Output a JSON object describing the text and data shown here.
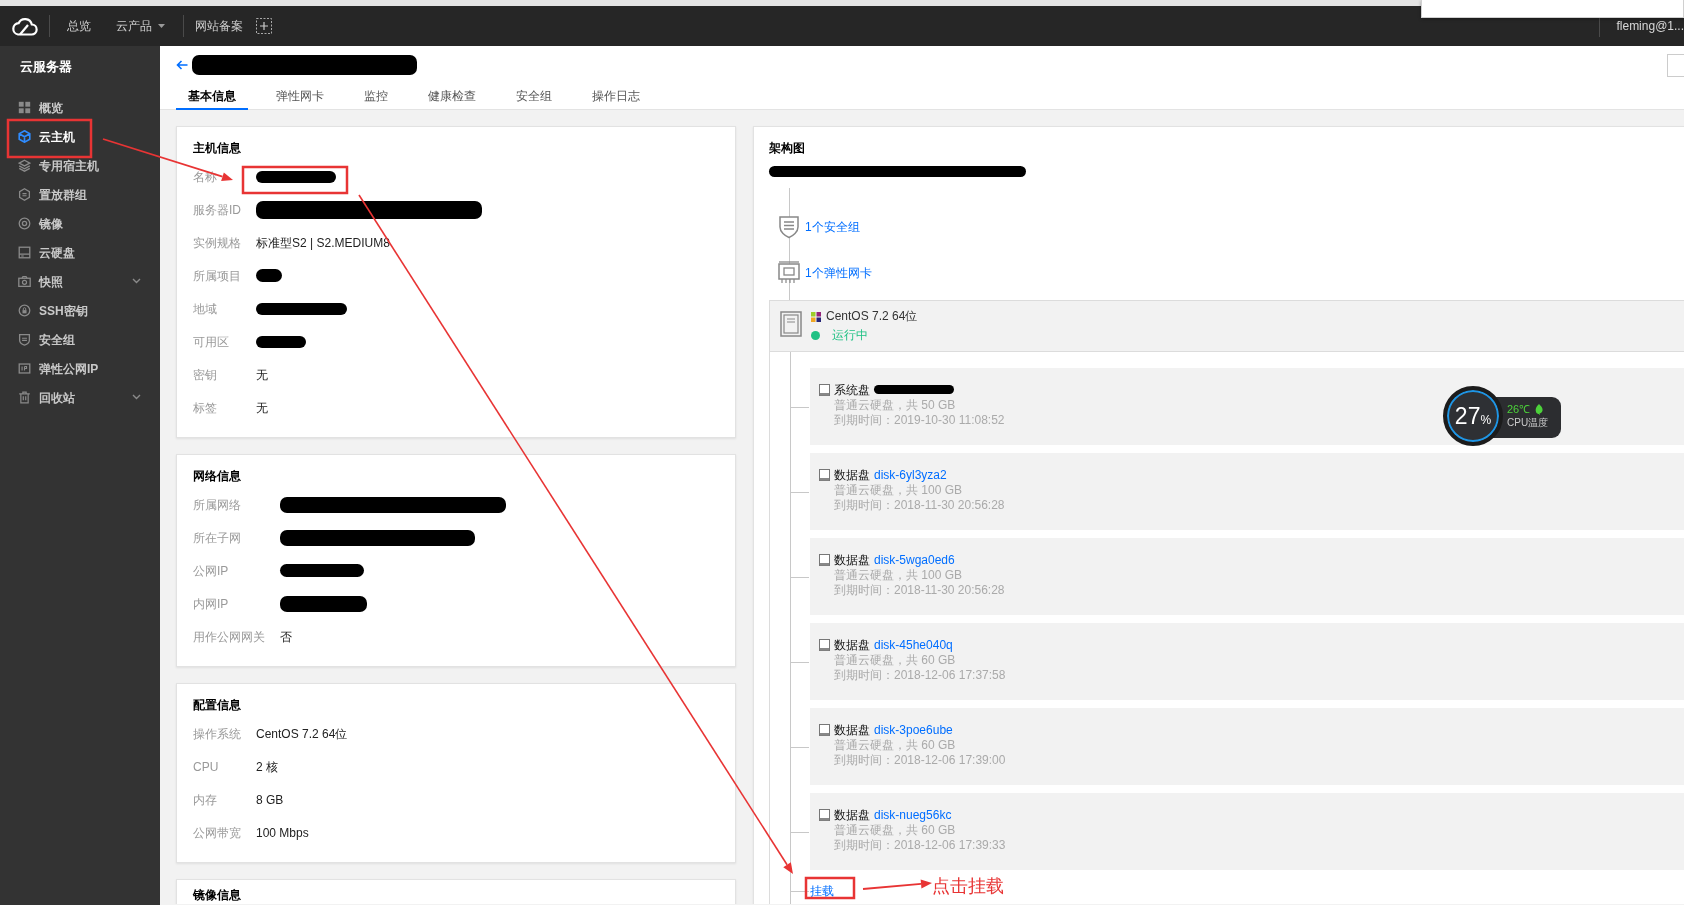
{
  "top_nav": {
    "items": [
      {
        "label": "总览",
        "kind": "link"
      },
      {
        "label": "云产品",
        "kind": "dropdown"
      },
      {
        "label": "网站备案",
        "kind": "link"
      }
    ],
    "user": "fleming@1..."
  },
  "sidebar": {
    "title": "云服务器",
    "items": [
      {
        "label": "概览",
        "kind": "overview",
        "selected": false,
        "expandable": false
      },
      {
        "label": "云主机",
        "kind": "instance",
        "selected": true,
        "expandable": false
      },
      {
        "label": "专用宿主机",
        "kind": "host",
        "selected": false,
        "expandable": false
      },
      {
        "label": "置放群组",
        "kind": "placement",
        "selected": false,
        "expandable": false
      },
      {
        "label": "镜像",
        "kind": "image",
        "selected": false,
        "expandable": false
      },
      {
        "label": "云硬盘",
        "kind": "disk",
        "selected": false,
        "expandable": false
      },
      {
        "label": "快照",
        "kind": "snapshot",
        "selected": false,
        "expandable": true
      },
      {
        "label": "SSH密钥",
        "kind": "ssh",
        "selected": false,
        "expandable": false
      },
      {
        "label": "安全组",
        "kind": "security",
        "selected": false,
        "expandable": false
      },
      {
        "label": "弹性公网IP",
        "kind": "eip",
        "selected": false,
        "expandable": false
      },
      {
        "label": "回收站",
        "kind": "recycle",
        "selected": false,
        "expandable": true
      }
    ]
  },
  "header": {
    "title_redacted": true,
    "tabs": [
      {
        "label": "基本信息",
        "selected": true
      },
      {
        "label": "弹性网卡",
        "selected": false
      },
      {
        "label": "监控",
        "selected": false
      },
      {
        "label": "健康检查",
        "selected": false
      },
      {
        "label": "安全组",
        "selected": false
      },
      {
        "label": "操作日志",
        "selected": false
      }
    ]
  },
  "info_cards": [
    {
      "title": "主机信息",
      "rows": [
        {
          "label": "名称",
          "redacted": true
        },
        {
          "label": "服务器ID",
          "redacted": true
        },
        {
          "label": "实例规格",
          "value": "标准型S2 | S2.MEDIUM8",
          "redacted": false
        },
        {
          "label": "所属项目",
          "redacted": true
        },
        {
          "label": "地域",
          "redacted": true
        },
        {
          "label": "可用区",
          "redacted": true
        },
        {
          "label": "密钥",
          "value": "无",
          "redacted": false
        },
        {
          "label": "标签",
          "value": "无",
          "redacted": false
        }
      ]
    },
    {
      "title": "网络信息",
      "rows": [
        {
          "label": "所属网络",
          "redacted": true
        },
        {
          "label": "所在子网",
          "redacted": true
        },
        {
          "label": "公网IP",
          "redacted": true
        },
        {
          "label": "内网IP",
          "redacted": true
        },
        {
          "label": "用作公网网关",
          "value": "否",
          "redacted": false
        }
      ]
    },
    {
      "title": "配置信息",
      "rows": [
        {
          "label": "操作系统",
          "value": "CentOS 7.2 64位",
          "redacted": false
        },
        {
          "label": "CPU",
          "value": "2 核",
          "redacted": false
        },
        {
          "label": "内存",
          "value": "8 GB",
          "redacted": false
        },
        {
          "label": "公网带宽",
          "value": "100 Mbps",
          "redacted": false
        }
      ]
    },
    {
      "title": "镜像信息"
    }
  ],
  "architecture": {
    "title": "架构图",
    "subtitle_redacted": true,
    "links": [
      {
        "kind": "security-group",
        "label": "1个安全组"
      },
      {
        "kind": "nic",
        "label": "1个弹性网卡"
      }
    ],
    "instance": {
      "os": "CentOS 7.2 64位",
      "status": "运行中",
      "running": true
    },
    "disks": [
      {
        "type": "系统盘",
        "id_redacted": true,
        "spec": "普通云硬盘，共 50 GB",
        "expiry": "到期时间：2019-10-30 11:08:52"
      },
      {
        "type": "数据盘",
        "id": "disk-6yl3yza2",
        "id_redacted": false,
        "spec": "普通云硬盘，共 100 GB",
        "expiry": "到期时间：2018-11-30 20:56:28"
      },
      {
        "type": "数据盘",
        "id": "disk-5wga0ed6",
        "id_redacted": false,
        "spec": "普通云硬盘，共 100 GB",
        "expiry": "到期时间：2018-11-30 20:56:28"
      },
      {
        "type": "数据盘",
        "id": "disk-45he040q",
        "id_redacted": false,
        "spec": "普通云硬盘，共 60 GB",
        "expiry": "到期时间：2018-12-06 17:37:58"
      },
      {
        "type": "数据盘",
        "id": "disk-3poe6ube",
        "id_redacted": false,
        "spec": "普通云硬盘，共 60 GB",
        "expiry": "到期时间：2018-12-06 17:39:00"
      },
      {
        "type": "数据盘",
        "id": "disk-nueg56kc",
        "id_redacted": false,
        "spec": "普通云硬盘，共 60 GB",
        "expiry": "到期时间：2018-12-06 17:39:33"
      }
    ],
    "mount_link": "挂载"
  },
  "cpu_widget": {
    "usage": "27",
    "unit": "%",
    "temperature": "26℃",
    "label": "CPU温度"
  },
  "annotation": {
    "callout": "点击挂载"
  }
}
